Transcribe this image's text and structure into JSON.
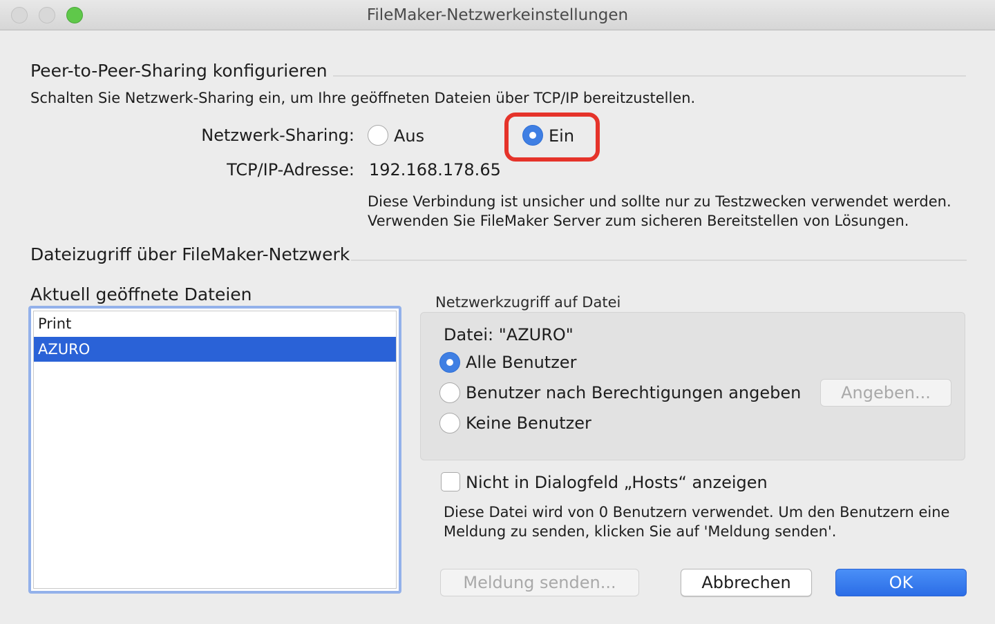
{
  "window": {
    "title": "FileMaker-Netzwerkeinstellungen"
  },
  "peer": {
    "section_title": "Peer-to-Peer-Sharing konfigurieren",
    "description": "Schalten Sie Netzwerk-Sharing ein, um Ihre geöffneten Dateien über TCP/IP bereitzustellen.",
    "sharing_label": "Netzwerk-Sharing:",
    "off_label": "Aus",
    "on_label": "Ein",
    "selected": "Ein",
    "ip_label": "TCP/IP-Adresse:",
    "ip_value": "192.168.178.65",
    "warning_line1": "Diese Verbindung ist unsicher und sollte nur zu Testzwecken verwendet werden.",
    "warning_line2": "Verwenden Sie FileMaker Server zum sicheren Bereitstellen von Lösungen."
  },
  "access": {
    "section_title": "Dateizugriff über FileMaker-Netzwerk",
    "files_label": "Aktuell geöffnete Dateien",
    "files": [
      {
        "name": "Print",
        "selected": false
      },
      {
        "name": "AZURO",
        "selected": true
      }
    ],
    "group_title": "Netzwerkzugriff auf Datei",
    "file_line": "Datei: \"AZURO\"",
    "option_all": "Alle Benutzer",
    "option_privileges": "Benutzer nach Berechtigungen angeben",
    "option_none": "Keine Benutzer",
    "selected_option": "Alle Benutzer",
    "specify_button": "Angeben...",
    "hosts_checkbox_label": "Nicht in Dialogfeld „Hosts“ anzeigen",
    "hosts_checked": false,
    "usage_line1": "Diese Datei wird von 0 Benutzern verwendet. Um den Benutzern eine",
    "usage_line2": "Meldung zu senden, klicken Sie auf 'Meldung senden'."
  },
  "buttons": {
    "send_message": "Meldung senden...",
    "cancel": "Abbrechen",
    "ok": "OK"
  },
  "colors": {
    "accent": "#2a62d7",
    "highlight": "#e5332a",
    "zoom_button": "#5fc84a"
  }
}
